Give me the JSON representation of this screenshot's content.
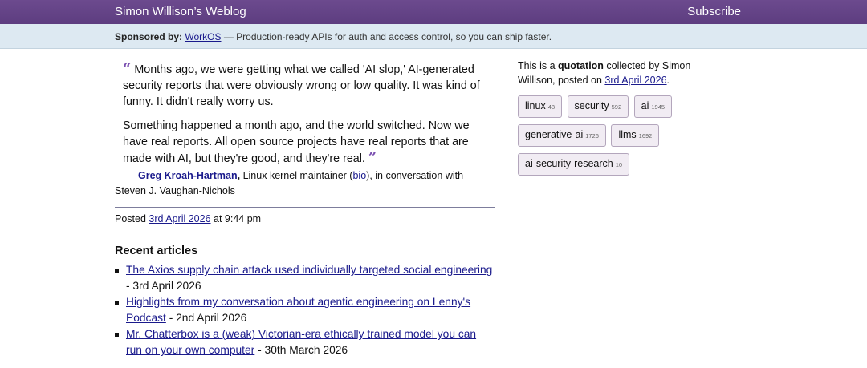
{
  "header": {
    "site_title": "Simon Willison’s Weblog",
    "subscribe_label": "Subscribe"
  },
  "sponsor": {
    "label": "Sponsored by:",
    "name": "WorkOS",
    "text": " — Production-ready APIs for auth and access control, so you can ship faster."
  },
  "quote": {
    "open_mark": "“",
    "close_mark": "”",
    "paragraph_1": "Months ago, we were getting what we called 'AI slop,' AI-generated security reports that were obviously wrong or low quality. It was kind of funny. It didn't really worry us.",
    "paragraph_2": "Something happened a month ago, and the world switched. Now we have real reports. All open source projects have real reports that are made with AI, but they're good, and they're real.",
    "dash": "— ",
    "author": "Greg Kroah-Hartman",
    "author_suffix": ",",
    "role": " Linux kernel maintainer (",
    "bio_link": "bio",
    "context": "), in conversation with Steven J. Vaughan-Nichols"
  },
  "posted": {
    "label": "Posted ",
    "date_link": "3rd April 2026",
    "time": " at 9:44 pm"
  },
  "recent": {
    "heading": "Recent articles",
    "items": [
      {
        "title": "The Axios supply chain attack used individually targeted social engineering",
        "date": " - 3rd April 2026"
      },
      {
        "title": "Highlights from my conversation about agentic engineering on Lenny's Podcast",
        "date": " - 2nd April 2026"
      },
      {
        "title": "Mr. Chatterbox is a (weak) Victorian-era ethically trained model you can run on your own computer",
        "date": " - 30th March 2026"
      }
    ]
  },
  "sidebar": {
    "intro_1": "This is a ",
    "intro_bold": "quotation",
    "intro_2": " collected by Simon Willison, posted on ",
    "date_link": "3rd April 2026",
    "intro_end": ".",
    "tags": [
      {
        "name": "linux",
        "count": "48"
      },
      {
        "name": "security",
        "count": "592"
      },
      {
        "name": "ai",
        "count": "1945"
      },
      {
        "name": "generative-ai",
        "count": "1726"
      },
      {
        "name": "llms",
        "count": "1692"
      },
      {
        "name": "ai-security-research",
        "count": "10"
      }
    ]
  }
}
